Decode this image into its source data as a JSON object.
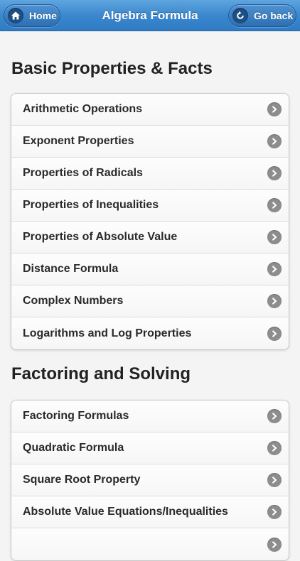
{
  "header": {
    "title": "Algebra Formula",
    "home_label": "Home",
    "back_label": "Go back"
  },
  "sections": [
    {
      "title": "Basic Properties & Facts",
      "items": [
        {
          "label": "Arithmetic Operations",
          "icon": "chevron-right-icon"
        },
        {
          "label": "Exponent Properties",
          "icon": "chevron-right-icon"
        },
        {
          "label": "Properties of Radicals",
          "icon": "chevron-right-icon"
        },
        {
          "label": "Properties of Inequalities",
          "icon": "chevron-right-icon"
        },
        {
          "label": "Properties of Absolute Value",
          "icon": "chevron-right-icon"
        },
        {
          "label": "Distance Formula",
          "icon": "chevron-right-icon"
        },
        {
          "label": "Complex Numbers",
          "icon": "chevron-right-icon"
        },
        {
          "label": "Logarithms and Log Properties",
          "icon": "chevron-right-icon"
        }
      ]
    },
    {
      "title": "Factoring and Solving",
      "items": [
        {
          "label": "Factoring Formulas",
          "icon": "chevron-right-icon"
        },
        {
          "label": "Quadratic Formula",
          "icon": "chevron-right-icon"
        },
        {
          "label": "Square Root Property",
          "icon": "chevron-right-icon"
        },
        {
          "label": "Absolute Value Equations/Inequalities",
          "icon": "chevron-right-icon"
        },
        {
          "label": "",
          "icon": "chevron-right-icon"
        }
      ]
    }
  ],
  "colors": {
    "header_blue": "#3b88cf",
    "chevron_gray": "#8d8d8d"
  }
}
